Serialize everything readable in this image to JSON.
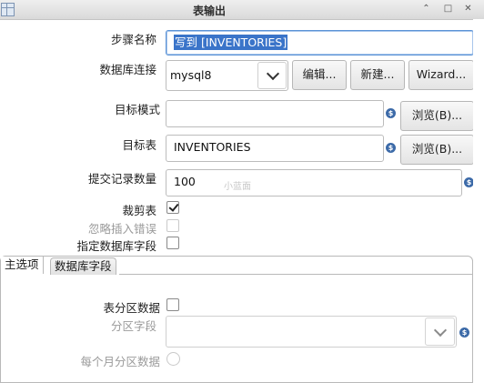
{
  "window": {
    "title": "表输出",
    "controls": {
      "minimize": "⌃",
      "maximize": "□",
      "close": "✕"
    }
  },
  "form": {
    "step_name": {
      "label": "步骤名称",
      "value": "写到 [INVENTORIES]"
    },
    "db_connection": {
      "label": "数据库连接",
      "value": "mysql8",
      "edit_button": "编辑...",
      "new_button": "新建...",
      "wizard_button": "Wizard..."
    },
    "target_schema": {
      "label": "目标模式",
      "value": "",
      "browse_button": "浏览(B)..."
    },
    "target_table": {
      "label": "目标表",
      "value": "INVENTORIES",
      "browse_button": "浏览(B)..."
    },
    "commit_size": {
      "label": "提交记录数量",
      "value": "100"
    },
    "truncate_table": {
      "label": "裁剪表",
      "checked": true
    },
    "ignore_insert_errors": {
      "label": "忽略插入错误",
      "checked": false,
      "enabled": false
    },
    "specify_db_fields": {
      "label": "指定数据库字段",
      "checked": false
    }
  },
  "variable_icon": "$",
  "tabs": [
    {
      "label": "主选项",
      "active": true
    },
    {
      "label": "数据库字段",
      "active": false
    }
  ],
  "main_options": {
    "partition_data": {
      "label": "表分区数据",
      "checked": false
    },
    "partition_field": {
      "label": "分区字段",
      "value": "",
      "enabled": false
    },
    "partition_monthly": {
      "label": "每个月分区数据",
      "enabled": false
    }
  },
  "watermark": "小蓝面"
}
